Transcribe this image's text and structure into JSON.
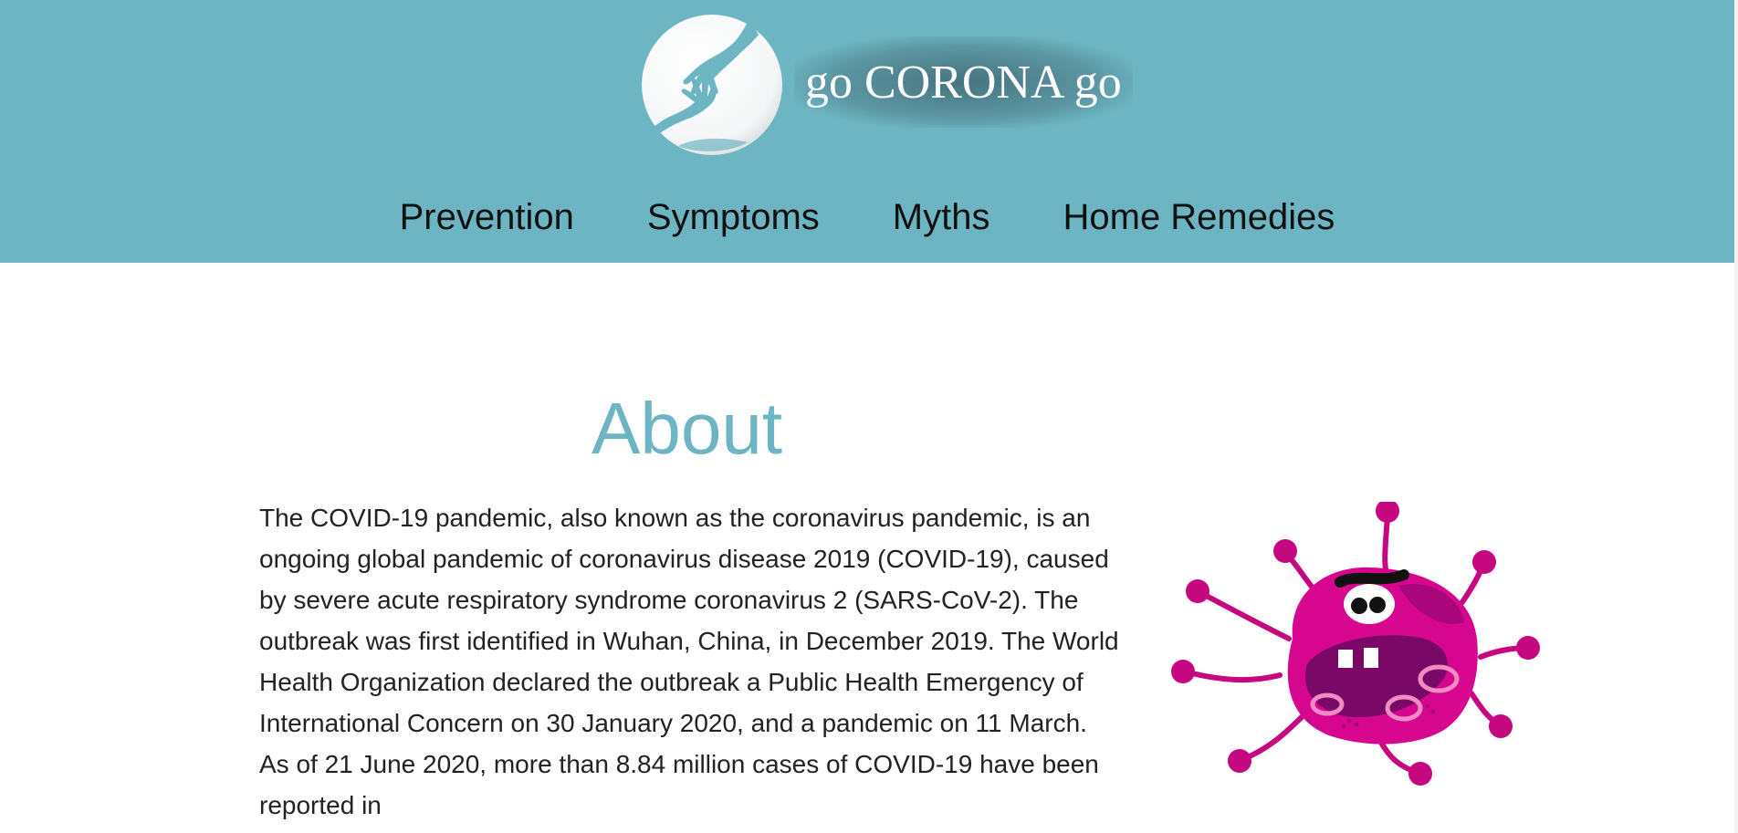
{
  "header": {
    "brand_title": "go CORONA go",
    "logo_icon": "caring-hands-icon",
    "background_color": "#6db5c2"
  },
  "nav": {
    "items": [
      {
        "label": "Prevention"
      },
      {
        "label": "Symptoms"
      },
      {
        "label": "Myths"
      },
      {
        "label": "Home Remedies"
      }
    ]
  },
  "about": {
    "title": "About",
    "title_color": "#6db5c2",
    "body": "The COVID-19 pandemic, also known as the coronavirus pandemic, is an ongoing global pandemic of coronavirus disease 2019 (COVID-19), caused by severe acute respiratory syndrome coronavirus 2 (SARS-CoV-2). The outbreak was first identified in Wuhan, China, in December 2019. The World Health Organization declared the outbreak a Public Health Emergency of International Concern on 30 January 2020, and a pandemic on 11 March. As of 21 June 2020, more than 8.84 million cases of COVID-19 have been reported in",
    "illustration_icon": "cartoon-virus-icon",
    "virus_color": "#d6068f"
  }
}
